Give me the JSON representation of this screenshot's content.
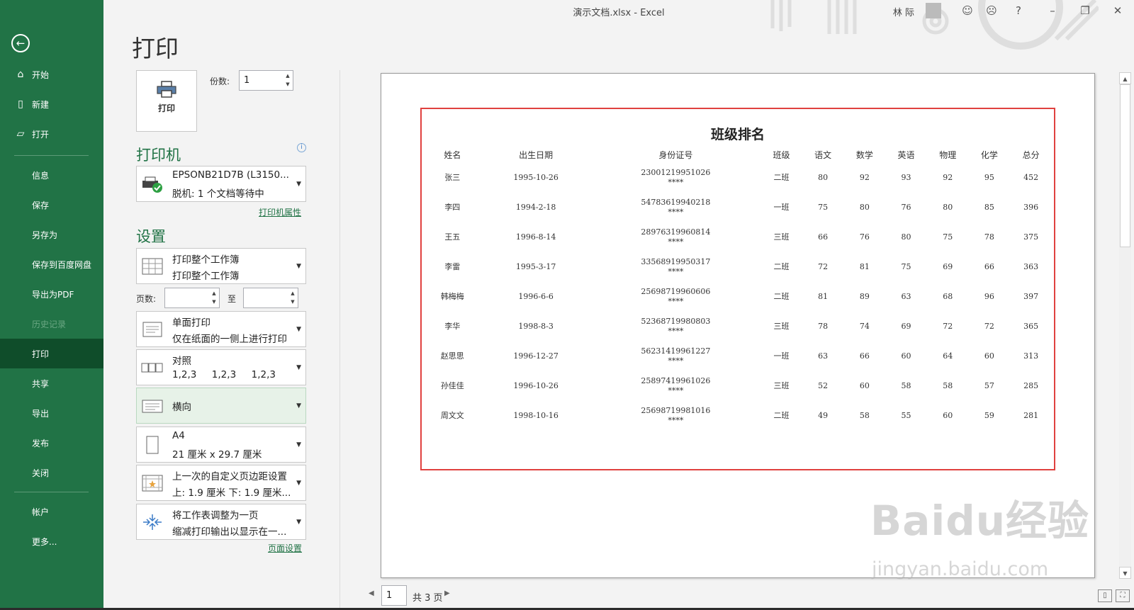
{
  "window": {
    "title": "演示文档.xlsx  -  Excel",
    "user": "林 际",
    "help": "?"
  },
  "sidebar": {
    "items": [
      {
        "label": "开始",
        "icon": "home-icon"
      },
      {
        "label": "新建",
        "icon": "new-file-icon"
      },
      {
        "label": "打开",
        "icon": "folder-open-icon"
      },
      {
        "label": "信息"
      },
      {
        "label": "保存"
      },
      {
        "label": "另存为"
      },
      {
        "label": "保存到百度网盘"
      },
      {
        "label": "导出为PDF"
      },
      {
        "label": "历史记录",
        "disabled": true
      },
      {
        "label": "打印",
        "active": true
      },
      {
        "label": "共享"
      },
      {
        "label": "导出"
      },
      {
        "label": "发布"
      },
      {
        "label": "关闭"
      },
      {
        "label": "帐户"
      },
      {
        "label": "更多..."
      }
    ]
  },
  "print": {
    "heading": "打印",
    "button_label": "打印",
    "copies_label": "份数:",
    "copies_value": "1"
  },
  "printer": {
    "section_title": "打印机",
    "name": "EPSONB21D7B (L3150...",
    "status": "脱机: 1 个文档等待中",
    "properties_link": "打印机属性"
  },
  "settings": {
    "section_title": "设置",
    "scope": {
      "line1": "打印整个工作簿",
      "line2": "打印整个工作簿"
    },
    "pages_label": "页数:",
    "to_label": "至",
    "sides": {
      "line1": "单面打印",
      "line2": "仅在纸面的一侧上进行打印"
    },
    "collate": {
      "line1": "对照",
      "line2": "1,2,3     1,2,3     1,2,3"
    },
    "orientation": {
      "line1": "横向"
    },
    "paper": {
      "line1": "A4",
      "line2": "21 厘米 x 29.7 厘米"
    },
    "margins": {
      "line1": "上一次的自定义页边距设置",
      "line2": "上: 1.9 厘米 下: 1.9 厘米..."
    },
    "scaling": {
      "line1": "将工作表调整为一页",
      "line2": "缩减打印输出以显示在一..."
    },
    "page_setup_link": "页面设置"
  },
  "preview": {
    "sheet_title": "班级排名",
    "headers": [
      "姓名",
      "出生日期",
      "身份证号",
      "班级",
      "语文",
      "数学",
      "英语",
      "物理",
      "化学",
      "总分"
    ],
    "rows": [
      {
        "name": "张三",
        "birth": "1995-10-26",
        "id": "23001219951026",
        "id_mask": "****",
        "class": "二班",
        "chinese": "80",
        "math": "92",
        "english": "93",
        "physics": "92",
        "chemistry": "95",
        "total": "452"
      },
      {
        "name": "李四",
        "birth": "1994-2-18",
        "id": "54783619940218",
        "id_mask": "****",
        "class": "一班",
        "chinese": "75",
        "math": "80",
        "english": "76",
        "physics": "80",
        "chemistry": "85",
        "total": "396"
      },
      {
        "name": "王五",
        "birth": "1996-8-14",
        "id": "28976319960814",
        "id_mask": "****",
        "class": "三班",
        "chinese": "66",
        "math": "76",
        "english": "80",
        "physics": "75",
        "chemistry": "78",
        "total": "375"
      },
      {
        "name": "李雷",
        "birth": "1995-3-17",
        "id": "33568919950317",
        "id_mask": "****",
        "class": "二班",
        "chinese": "72",
        "math": "81",
        "english": "75",
        "physics": "69",
        "chemistry": "66",
        "total": "363"
      },
      {
        "name": "韩梅梅",
        "birth": "1996-6-6",
        "id": "25698719960606",
        "id_mask": "****",
        "class": "二班",
        "chinese": "81",
        "math": "89",
        "english": "63",
        "physics": "68",
        "chemistry": "96",
        "total": "397"
      },
      {
        "name": "李华",
        "birth": "1998-8-3",
        "id": "52368719980803",
        "id_mask": "****",
        "class": "三班",
        "chinese": "78",
        "math": "74",
        "english": "69",
        "physics": "72",
        "chemistry": "72",
        "total": "365"
      },
      {
        "name": "赵思思",
        "birth": "1996-12-27",
        "id": "56231419961227",
        "id_mask": "****",
        "class": "一班",
        "chinese": "63",
        "math": "66",
        "english": "60",
        "physics": "64",
        "chemistry": "60",
        "total": "313"
      },
      {
        "name": "孙佳佳",
        "birth": "1996-10-26",
        "id": "25897419961026",
        "id_mask": "****",
        "class": "三班",
        "chinese": "52",
        "math": "60",
        "english": "58",
        "physics": "58",
        "chemistry": "57",
        "total": "285"
      },
      {
        "name": "周文文",
        "birth": "1998-10-16",
        "id": "25698719981016",
        "id_mask": "****",
        "class": "二班",
        "chinese": "49",
        "math": "58",
        "english": "55",
        "physics": "60",
        "chemistry": "59",
        "total": "281"
      }
    ]
  },
  "pager": {
    "current": "1",
    "total_label": "共 3 页"
  },
  "watermark": {
    "logo": "Baidu经验",
    "url": "jingyan.baidu.com"
  },
  "colors": {
    "sidebar": "#217346",
    "sidebar_active": "#0f4d2a",
    "accent": "#217346",
    "print_area_border": "#e0413f"
  }
}
